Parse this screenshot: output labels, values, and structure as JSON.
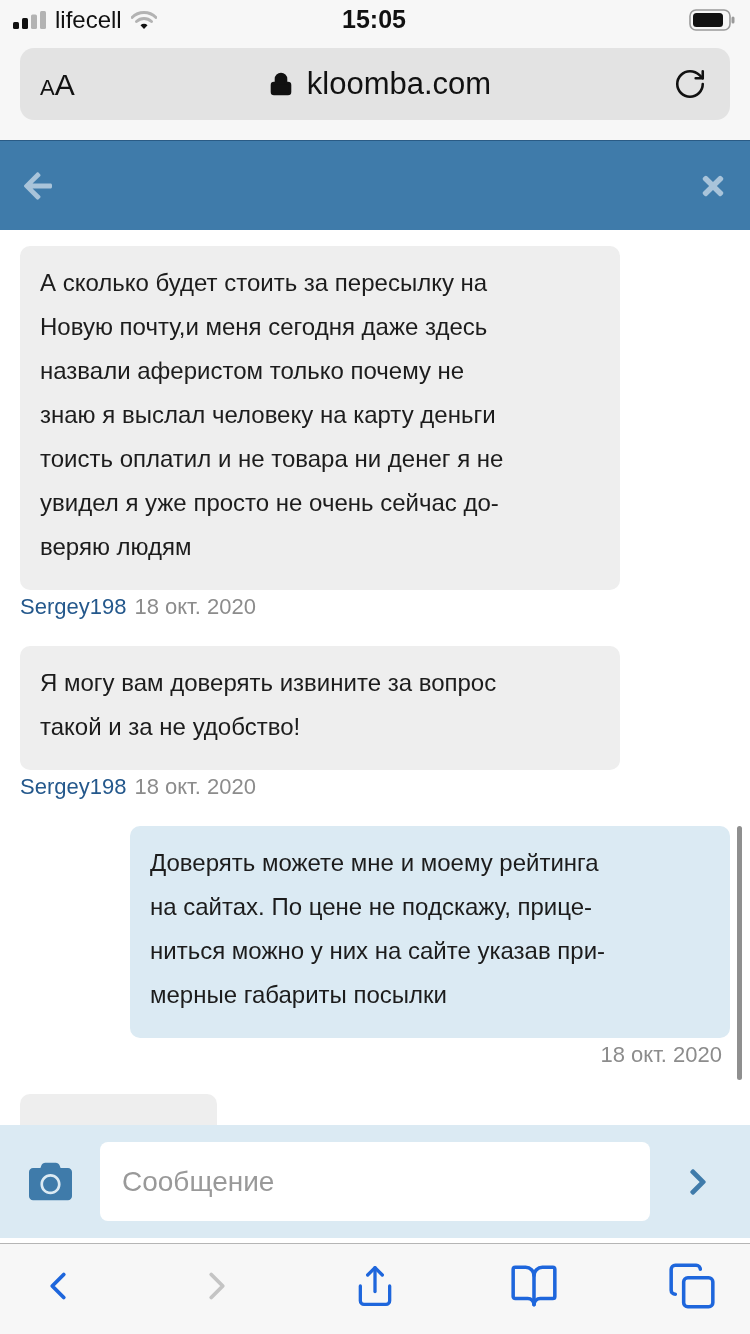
{
  "status_bar": {
    "carrier": "lifecell",
    "time": "15:05"
  },
  "address_bar": {
    "text_size_button": "AA",
    "url": "kloomba.com"
  },
  "messages": [
    {
      "kind": "incoming",
      "text": "А сколько будет стоить за пересылку на\nНовую почту,и меня сегодня даже здесь\nназвали аферистом только почему не\nзнаю я выслал человеку на карту деньги\nтоисть оплатил и не товара ни денег я не\nувидел я уже просто не очень сейчас до-\nверяю людям",
      "author": "Sergey198",
      "date": "18 окт. 2020"
    },
    {
      "kind": "incoming",
      "text": "Я могу вам доверять извините за вопрос\nтакой и за не удобство!",
      "author": "Sergey198",
      "date": "18 окт. 2020"
    },
    {
      "kind": "outgoing",
      "text": "Доверять можете мне и моему рейтинга\nна сайтах. По цене не подскажу, прице-\nниться можно у них на сайте указав при-\nмерные габариты посылки",
      "date": "18 окт. 2020"
    },
    {
      "kind": "clipped"
    }
  ],
  "composer": {
    "placeholder": "Сообщение"
  },
  "browser_toolbar": [
    {
      "kind": "back",
      "disabled": false
    },
    {
      "kind": "forward",
      "disabled": true
    },
    {
      "kind": "share"
    },
    {
      "kind": "bookmarks"
    },
    {
      "kind": "tabs"
    }
  ]
}
